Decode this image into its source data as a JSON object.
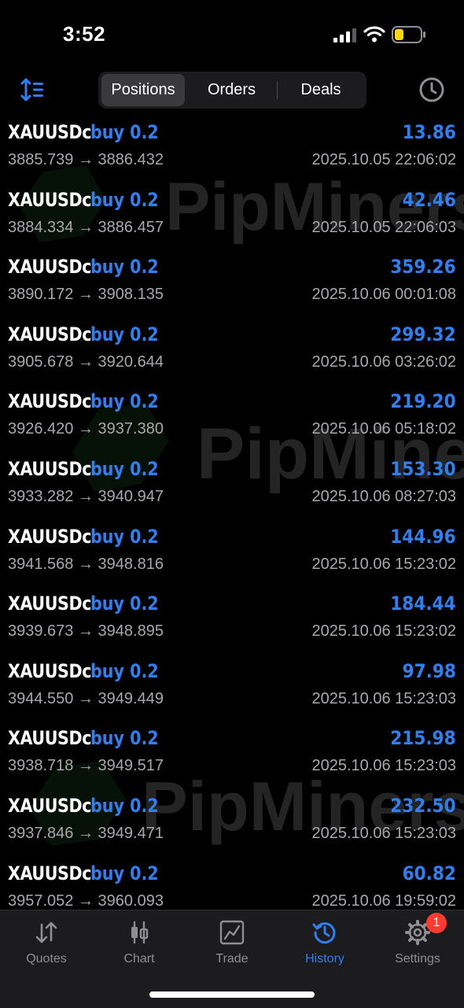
{
  "status_bar": {
    "time": "3:52"
  },
  "toolbar": {
    "segments": [
      "Positions",
      "Orders",
      "Deals"
    ],
    "active_segment": "Positions"
  },
  "rows": [
    {
      "symbol": "XAUUSDc",
      "side": "buy 0.2",
      "profit": "13.86",
      "prices": "3885.739 → 3886.432",
      "datetime": "2025.10.05 22:06:02"
    },
    {
      "symbol": "XAUUSDc",
      "side": "buy 0.2",
      "profit": "42.46",
      "prices": "3884.334 → 3886.457",
      "datetime": "2025.10.05 22:06:03"
    },
    {
      "symbol": "XAUUSDc",
      "side": "buy 0.2",
      "profit": "359.26",
      "prices": "3890.172 → 3908.135",
      "datetime": "2025.10.06 00:01:08"
    },
    {
      "symbol": "XAUUSDc",
      "side": "buy 0.2",
      "profit": "299.32",
      "prices": "3905.678 → 3920.644",
      "datetime": "2025.10.06 03:26:02"
    },
    {
      "symbol": "XAUUSDc",
      "side": "buy 0.2",
      "profit": "219.20",
      "prices": "3926.420 → 3937.380",
      "datetime": "2025.10.06 05:18:02"
    },
    {
      "symbol": "XAUUSDc",
      "side": "buy 0.2",
      "profit": "153.30",
      "prices": "3933.282 → 3940.947",
      "datetime": "2025.10.06 08:27:03"
    },
    {
      "symbol": "XAUUSDc",
      "side": "buy 0.2",
      "profit": "144.96",
      "prices": "3941.568 → 3948.816",
      "datetime": "2025.10.06 15:23:02"
    },
    {
      "symbol": "XAUUSDc",
      "side": "buy 0.2",
      "profit": "184.44",
      "prices": "3939.673 → 3948.895",
      "datetime": "2025.10.06 15:23:02"
    },
    {
      "symbol": "XAUUSDc",
      "side": "buy 0.2",
      "profit": "97.98",
      "prices": "3944.550 → 3949.449",
      "datetime": "2025.10.06 15:23:03"
    },
    {
      "symbol": "XAUUSDc",
      "side": "buy 0.2",
      "profit": "215.98",
      "prices": "3938.718 → 3949.517",
      "datetime": "2025.10.06 15:23:03"
    },
    {
      "symbol": "XAUUSDc",
      "side": "buy 0.2",
      "profit": "232.50",
      "prices": "3937.846 → 3949.471",
      "datetime": "2025.10.06 15:23:03"
    },
    {
      "symbol": "XAUUSDc",
      "side": "buy 0.2",
      "profit": "60.82",
      "prices": "3957.052 → 3960.093",
      "datetime": "2025.10.06 19:59:02"
    }
  ],
  "watermark": {
    "text": "PipMiners"
  },
  "tabbar": {
    "tabs": [
      {
        "label": "Quotes",
        "icon": "quotes-arrows-icon"
      },
      {
        "label": "Chart",
        "icon": "candlestick-icon"
      },
      {
        "label": "Trade",
        "icon": "trade-chart-icon"
      },
      {
        "label": "History",
        "icon": "history-clock-icon"
      },
      {
        "label": "Settings",
        "icon": "gear-icon"
      }
    ],
    "active_tab": "History",
    "settings_badge": "1"
  },
  "colors": {
    "accent": "#2f7ff0",
    "badge": "#ff3b30",
    "muted": "#a8a8ad"
  }
}
